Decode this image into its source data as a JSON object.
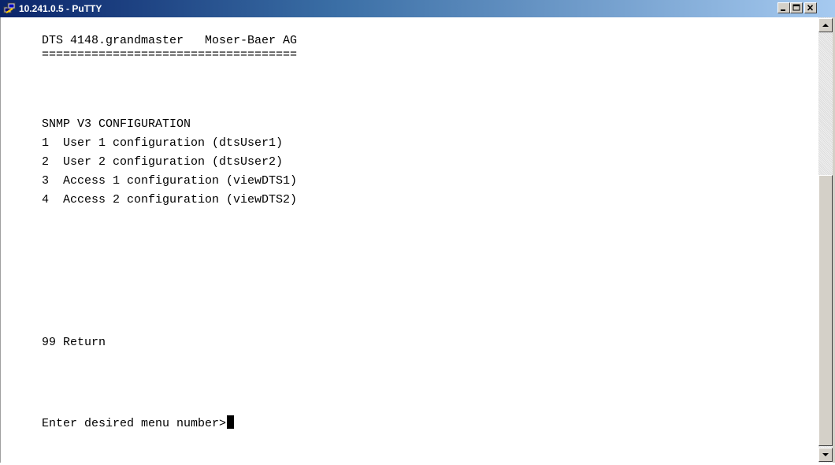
{
  "window": {
    "title": "10.241.0.5 - PuTTY",
    "title_icon": "putty-icon"
  },
  "terminal": {
    "lines": [
      "DTS 4148.grandmaster   Moser-Baer AG",
      "====================================",
      "",
      "SNMP V3 CONFIGURATION",
      "1  User 1 configuration (dtsUser1)",
      "2  User 2 configuration (dtsUser2)",
      "3  Access 1 configuration (viewDTS1)",
      "4  Access 2 configuration (viewDTS2)",
      "99 Return",
      "Enter desired menu number>"
    ]
  },
  "colors": {
    "title_bar_start": "#0a246a",
    "title_bar_end": "#a6caf0",
    "terminal_bg": "#ffffff",
    "terminal_fg": "#000000"
  }
}
